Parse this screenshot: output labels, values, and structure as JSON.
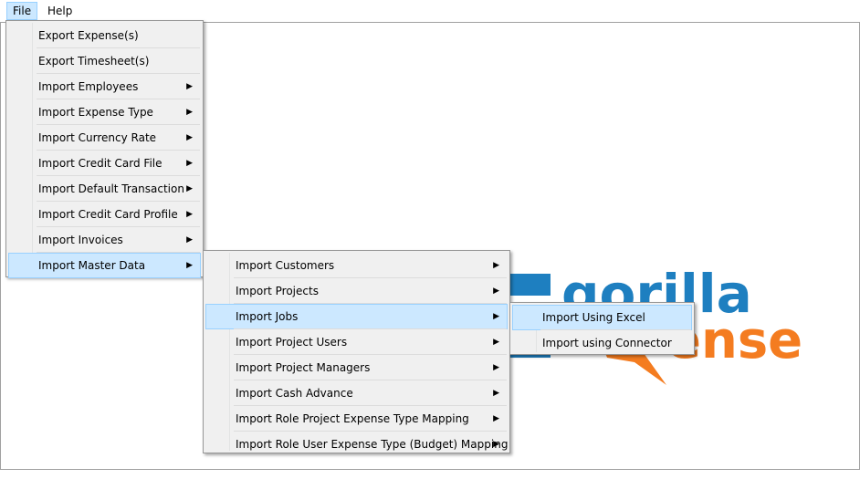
{
  "menubar": {
    "file": "File",
    "help": "Help"
  },
  "file_menu": {
    "items": [
      {
        "label": "Export Expense(s)",
        "submenu": false
      },
      {
        "label": "Export Timesheet(s)",
        "submenu": false
      },
      {
        "label": "Import Employees",
        "submenu": true
      },
      {
        "label": "Import Expense Type",
        "submenu": true
      },
      {
        "label": "Import Currency Rate",
        "submenu": true
      },
      {
        "label": "Import Credit Card File",
        "submenu": true
      },
      {
        "label": "Import Default Transaction",
        "submenu": true
      },
      {
        "label": "Import Credit Card Profile",
        "submenu": true
      },
      {
        "label": "Import Invoices",
        "submenu": true
      },
      {
        "label": "Import Master Data",
        "submenu": true,
        "highlighted": true
      }
    ]
  },
  "master_data_menu": {
    "items": [
      {
        "label": "Import Customers"
      },
      {
        "label": "Import Projects"
      },
      {
        "label": "Import Jobs",
        "highlighted": true
      },
      {
        "label": "Import Project Users"
      },
      {
        "label": "Import Project Managers"
      },
      {
        "label": "Import Cash Advance"
      },
      {
        "label": "Import Role Project Expense Type Mapping"
      },
      {
        "label": "Import Role User Expense Type (Budget) Mapping"
      }
    ]
  },
  "jobs_menu": {
    "items": [
      {
        "label": "Import Using Excel",
        "highlighted": true
      },
      {
        "label": "Import using Connector"
      }
    ]
  },
  "submenu_arrow": "▶",
  "logo": {
    "word1": "gorilla",
    "word2": "expense",
    "color_blue": "#1e7fc0",
    "color_orange": "#f47c20"
  }
}
